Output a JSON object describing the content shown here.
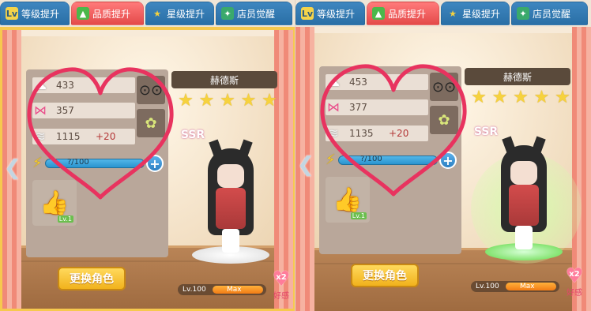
{
  "tabs": [
    {
      "label": "等级提升",
      "icon": "level-up-icon",
      "badge": "Lv"
    },
    {
      "label": "品质提升",
      "icon": "quality-up-icon"
    },
    {
      "label": "星级提升",
      "icon": "star-up-icon"
    },
    {
      "label": "店员觉醒",
      "icon": "awaken-icon"
    }
  ],
  "colors": {
    "active_tab": "#e44a4a",
    "inactive_tab": "#2a6fa6",
    "energy": "#2a94cf",
    "level_bar": "#f27c15",
    "annotation": "#e8335f"
  },
  "panels": [
    {
      "stats": [
        {
          "icon": "chef-hat-icon",
          "value": "433"
        },
        {
          "icon": "bow-icon",
          "value": "357"
        },
        {
          "icon": "wing-icon",
          "value": "1115",
          "bonus": "+20"
        }
      ],
      "energy": {
        "text": "?/100"
      },
      "skill_level": "Lv.1",
      "change_button": "更换角色",
      "character": {
        "name": "赫德斯",
        "rarity": "SSR",
        "stars": 5,
        "level": "Lv.100",
        "level_state": "Max"
      },
      "favor": {
        "multiplier": "x2",
        "label": "好感"
      }
    },
    {
      "stats": [
        {
          "icon": "chef-hat-icon",
          "value": "453"
        },
        {
          "icon": "bow-icon",
          "value": "377"
        },
        {
          "icon": "wing-icon",
          "value": "1135",
          "bonus": "+20"
        }
      ],
      "energy": {
        "text": "?/100"
      },
      "skill_level": "Lv.1",
      "change_button": "更换角色",
      "character": {
        "name": "赫德斯",
        "rarity": "SSR",
        "stars": 5,
        "level": "Lv.100",
        "level_state": "Max"
      },
      "favor": {
        "multiplier": "x2",
        "label": "好感"
      }
    }
  ]
}
